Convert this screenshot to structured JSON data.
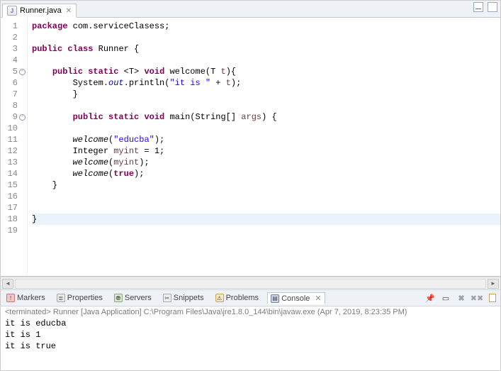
{
  "tab": {
    "filename": "Runner.java",
    "icon": "J"
  },
  "lines": [
    {
      "n": 1,
      "fold": "",
      "html": "<span class='kw'>package</span> com.serviceClasess;"
    },
    {
      "n": 2,
      "fold": "",
      "html": ""
    },
    {
      "n": 3,
      "fold": "",
      "html": "<span class='kw'>public</span> <span class='kw'>class</span> Runner {"
    },
    {
      "n": 4,
      "fold": "",
      "html": ""
    },
    {
      "n": 5,
      "fold": "⊖",
      "html": "    <span class='kw'>public</span> <span class='kw'>static</span> &lt;T&gt; <span class='kw'>void</span> welcome(T <span class='param'>t</span>){"
    },
    {
      "n": 6,
      "fold": "",
      "html": "        System.<span class='fld'>out</span>.println(<span class='str'>\"it is \"</span> + <span class='param'>t</span>);"
    },
    {
      "n": 7,
      "fold": "",
      "html": "        }"
    },
    {
      "n": 8,
      "fold": "",
      "html": ""
    },
    {
      "n": 9,
      "fold": "⊖",
      "html": "        <span class='kw'>public</span> <span class='kw'>static</span> <span class='kw'>void</span> main(String[] <span class='param'>args</span>) {"
    },
    {
      "n": 10,
      "fold": "",
      "html": ""
    },
    {
      "n": 11,
      "fold": "",
      "html": "        <span class='mname'>welcome</span>(<span class='str'>\"educba\"</span>);"
    },
    {
      "n": 12,
      "fold": "",
      "html": "        Integer <span class='param'>myint</span> = 1;"
    },
    {
      "n": 13,
      "fold": "",
      "html": "        <span class='mname'>welcome</span>(<span class='param'>myint</span>);"
    },
    {
      "n": 14,
      "fold": "",
      "html": "        <span class='mname'>welcome</span>(<span class='kw'>true</span>);"
    },
    {
      "n": 15,
      "fold": "",
      "html": "    }"
    },
    {
      "n": 16,
      "fold": "",
      "html": ""
    },
    {
      "n": 17,
      "fold": "",
      "html": ""
    },
    {
      "n": 18,
      "fold": "",
      "html": "}",
      "hl": true
    },
    {
      "n": 19,
      "fold": "",
      "html": ""
    }
  ],
  "views": {
    "markers": "Markers",
    "properties": "Properties",
    "servers": "Servers",
    "snippets": "Snippets",
    "problems": "Problems",
    "console": "Console"
  },
  "console": {
    "desc": "<terminated> Runner [Java Application] C:\\Program Files\\Java\\jre1.8.0_144\\bin\\javaw.exe (Apr 7, 2019, 8:23:35 PM)",
    "output": [
      "it is educba",
      "it is 1",
      "it is true"
    ]
  }
}
